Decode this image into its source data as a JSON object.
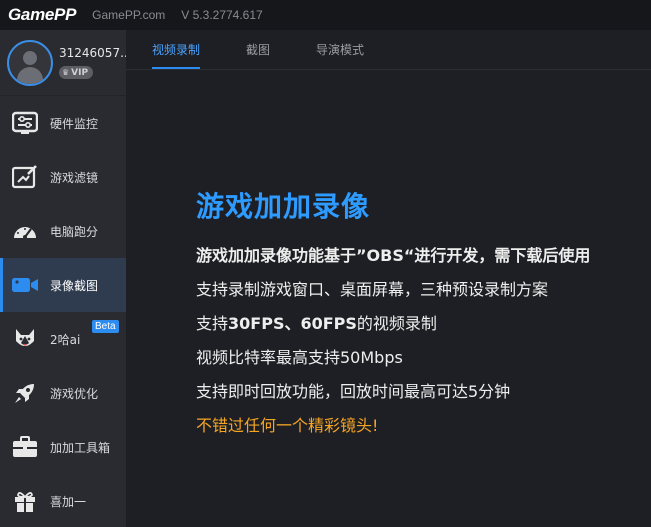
{
  "titlebar": {
    "logo": "GamePP",
    "site": "GamePP.com",
    "version": "V 5.3.2774.617"
  },
  "profile": {
    "uid": "31246057...",
    "vip": "VIP"
  },
  "sidebar": {
    "items": [
      {
        "label": "硬件监控",
        "icon": "hardware-monitor-icon"
      },
      {
        "label": "游戏滤镜",
        "icon": "game-filter-icon"
      },
      {
        "label": "电脑跑分",
        "icon": "benchmark-gauge-icon"
      },
      {
        "label": "录像截图",
        "icon": "video-camera-icon"
      },
      {
        "label": "2哈ai",
        "icon": "husky-icon",
        "badge": "Beta"
      },
      {
        "label": "游戏优化",
        "icon": "rocket-icon"
      },
      {
        "label": "加加工具箱",
        "icon": "toolbox-icon"
      },
      {
        "label": "喜加一",
        "icon": "gift-icon"
      }
    ],
    "active_index": 3
  },
  "tabs": [
    {
      "label": "视频录制"
    },
    {
      "label": "截图"
    },
    {
      "label": "导演模式"
    }
  ],
  "content": {
    "headline": "游戏加加录像",
    "line1": "游戏加加录像功能基于”OBS“进行开发，需下载后使用",
    "line2": "支持录制游戏窗口、桌面屏幕，三种预设录制方案",
    "line3_pre": "支持",
    "line3_bold": "30FPS、60FPS",
    "line3_post": "的视频录制",
    "line4": "视频比特率最高支持50Mbps",
    "line5": "支持即时回放功能，回放时间最高可达5分钟",
    "line6": "不错过任何一个精彩镜头!"
  },
  "colors": {
    "accent": "#2d8cf0",
    "headline": "#2d9bff",
    "highlight": "#f5a524",
    "sidebar_bg": "#2a2b30",
    "main_bg": "#1e1f24"
  }
}
